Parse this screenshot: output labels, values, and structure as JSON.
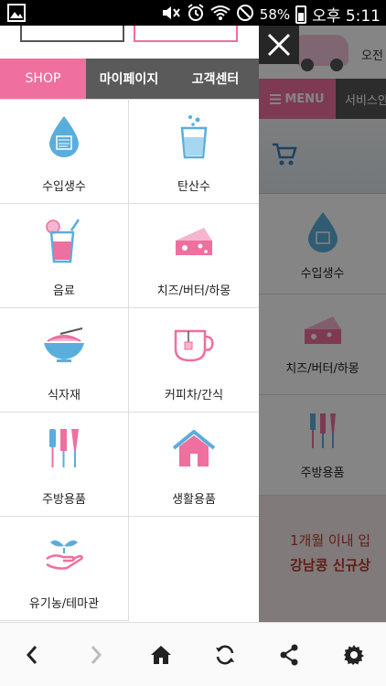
{
  "status_bar": {
    "battery": "58%",
    "time": "오후 5:11"
  },
  "drawer": {
    "tabs": [
      {
        "label": "SHOP"
      },
      {
        "label": "마이페이지"
      },
      {
        "label": "고객센터"
      }
    ],
    "categories": [
      {
        "label": "수입생수",
        "icon": "water-drop-icon"
      },
      {
        "label": "탄산수",
        "icon": "sparkling-glass-icon"
      },
      {
        "label": "음료",
        "icon": "drink-glass-icon"
      },
      {
        "label": "치즈/버터/하몽",
        "icon": "cheese-icon"
      },
      {
        "label": "식자재",
        "icon": "noodle-bowl-icon"
      },
      {
        "label": "커피차/간식",
        "icon": "tea-cup-icon"
      },
      {
        "label": "주방용품",
        "icon": "kitchen-utensils-icon"
      },
      {
        "label": "생활용품",
        "icon": "house-icon"
      },
      {
        "label": "유기농/테마관",
        "icon": "sprout-hand-icon"
      }
    ]
  },
  "background_page": {
    "header_text": "오전",
    "menu_label": "MENU",
    "service_label": "서비스안",
    "tiles": [
      {
        "label": "수입생수"
      },
      {
        "label": "치즈/버터/하몽"
      },
      {
        "label": "주방용품"
      }
    ],
    "promo_line1": "1개월 이내 입",
    "promo_line2": "강남콩 신규상"
  },
  "colors": {
    "accent": "#ef6f9e",
    "tab_dark": "#5a5a5a",
    "icon_blue": "#5aaedc"
  }
}
